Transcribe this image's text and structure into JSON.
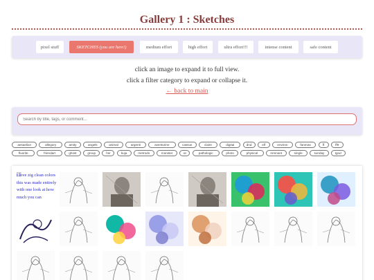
{
  "page": {
    "title": "Gallery 1 : Sketches"
  },
  "nav": {
    "items": [
      {
        "label": "pixel stuff",
        "active": false
      },
      {
        "label": "SKETCHES (you are here!)",
        "active": true
      },
      {
        "label": "medium effort",
        "active": false
      },
      {
        "label": "high effort",
        "active": false
      },
      {
        "label": "ultra effort!!!",
        "active": false
      },
      {
        "label": "intense content",
        "active": false
      },
      {
        "label": "safe content",
        "active": false
      }
    ]
  },
  "instructions": {
    "line1": "click an image to expand it to full view.",
    "line2": "click a filter category to expand or collapse it.",
    "back_link": "← back to main"
  },
  "search": {
    "placeholder": "Search by title, tags, or comment..."
  },
  "tags": [
    "aesaelion",
    "allegory",
    "amity",
    "angels",
    "animal",
    "argenti",
    "aventurine",
    "cassus",
    "claire",
    "digital",
    "dnd",
    "elf",
    "environ",
    "fanmisc",
    "ff",
    "ff9",
    "fluorite",
    "friendart",
    "ghost",
    "group",
    "hsr",
    "kuja",
    "metrodo",
    "monster",
    "oc",
    "pathologic",
    "photo",
    "physical",
    "remnant",
    "single",
    "sunday",
    "tgod"
  ],
  "gallery": {
    "first_alt_text": "i love zig clean colors this was made entirely with one look at how much you can",
    "thumbnails": [
      {
        "name": "thumb-1",
        "kind": "broken"
      },
      {
        "name": "thumb-2",
        "kind": "sketch"
      },
      {
        "name": "thumb-3",
        "kind": "gray"
      },
      {
        "name": "thumb-4",
        "kind": "sketch"
      },
      {
        "name": "thumb-5",
        "kind": "gray"
      },
      {
        "name": "thumb-6",
        "kind": "color"
      },
      {
        "name": "thumb-7",
        "kind": "color"
      },
      {
        "name": "thumb-8",
        "kind": "color"
      },
      {
        "name": "thumb-9",
        "kind": "ink"
      },
      {
        "name": "thumb-10",
        "kind": "sketch"
      },
      {
        "name": "thumb-11",
        "kind": "color"
      },
      {
        "name": "thumb-12",
        "kind": "color"
      },
      {
        "name": "thumb-13",
        "kind": "color"
      },
      {
        "name": "thumb-14",
        "kind": "sketch"
      },
      {
        "name": "thumb-15",
        "kind": "sketch"
      },
      {
        "name": "thumb-16",
        "kind": "sketch"
      },
      {
        "name": "thumb-17",
        "kind": "sketch"
      },
      {
        "name": "thumb-18",
        "kind": "sketch"
      },
      {
        "name": "thumb-19",
        "kind": "sketch"
      },
      {
        "name": "thumb-20",
        "kind": "sketch"
      }
    ]
  },
  "colors": {
    "accent": "#e9776e",
    "panel": "#e9e6f7",
    "title": "#8a3b3b",
    "link": "#d9534f"
  }
}
